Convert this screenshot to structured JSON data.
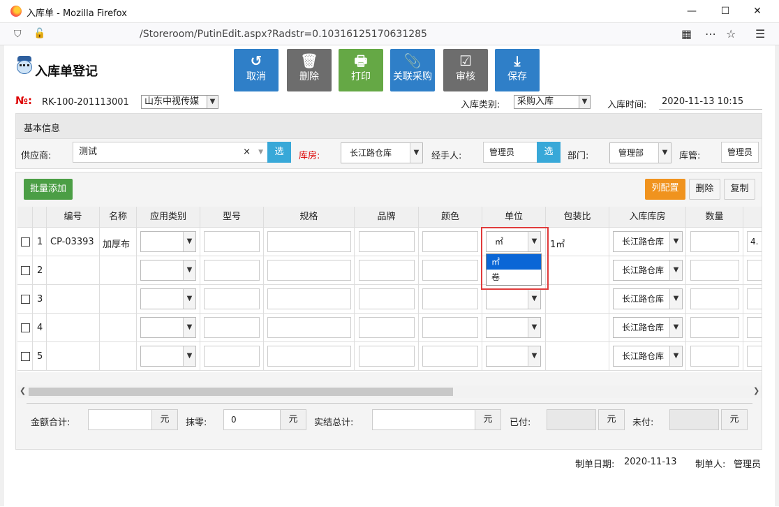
{
  "window": {
    "title": "入库单 - Mozilla Firefox",
    "url": "/Storeroom/PutinEdit.aspx?Radstr=0.10316125170631285",
    "min": "—",
    "max": "☐",
    "close": "✕"
  },
  "page": {
    "title": "入库单登记"
  },
  "toolbar": [
    {
      "icon": "↺",
      "label": "取消"
    },
    {
      "icon": "🗑",
      "label": "删除"
    },
    {
      "icon": "🖶",
      "label": "打印"
    },
    {
      "icon": "📎",
      "label": "关联采购"
    },
    {
      "icon": "☑",
      "label": "审核"
    },
    {
      "icon": "⤓",
      "label": "保存"
    }
  ],
  "header": {
    "no_label": "№:",
    "no_value": "RK-100-201113001",
    "company": "山东中视传媒",
    "type_label": "入库类别:",
    "type_value": "采购入库",
    "time_label": "入库时间:",
    "time_value": "2020-11-13 10:15"
  },
  "basic": {
    "title": "基本信息",
    "supplier_label": "供应商:",
    "supplier_value": "测试",
    "supplier_pick": "选",
    "warehouse_label": "库房:",
    "warehouse_value": "长江路仓库",
    "handler_label": "经手人:",
    "handler_value": "管理员",
    "handler_pick": "选",
    "dept_label": "部门:",
    "dept_value": "管理部",
    "keeper_label": "库管:",
    "keeper_value": "管理员"
  },
  "grid": {
    "add_button": "批量添加",
    "config_button": "列配置",
    "delete_button": "删除",
    "copy_button": "复制",
    "columns": [
      "编号",
      "名称",
      "应用类别",
      "型号",
      "规格",
      "品牌",
      "颜色",
      "单位",
      "包装比",
      "入库库房",
      "数量"
    ],
    "rows": [
      {
        "num": "1",
        "code": "CP-03393",
        "name": "加厚布",
        "unit": "㎡",
        "pack": "1㎡",
        "warehouse": "长江路仓库",
        "next": "4."
      },
      {
        "num": "2",
        "code": "",
        "name": "",
        "unit": "",
        "pack": "",
        "warehouse": "长江路仓库",
        "next": ""
      },
      {
        "num": "3",
        "code": "",
        "name": "",
        "unit": "",
        "pack": "",
        "warehouse": "长江路仓库",
        "next": ""
      },
      {
        "num": "4",
        "code": "",
        "name": "",
        "unit": "",
        "pack": "",
        "warehouse": "长江路仓库",
        "next": ""
      },
      {
        "num": "5",
        "code": "",
        "name": "",
        "unit": "",
        "pack": "",
        "warehouse": "长江路仓库",
        "next": ""
      }
    ],
    "unit_options": [
      "㎡",
      "卷"
    ]
  },
  "totals": {
    "amount_label": "金额合计:",
    "amount_value": "",
    "zero_label": "抹零:",
    "zero_value": "0",
    "settle_label": "实结总计:",
    "settle_value": "",
    "paid_label": "已付:",
    "paid_value": "",
    "unpaid_label": "未付:",
    "unpaid_value": "",
    "currency": "元"
  },
  "footer": {
    "date_label": "制单日期:",
    "date_value": "2020-11-13",
    "maker_label": "制单人:",
    "maker_value": "管理员"
  }
}
